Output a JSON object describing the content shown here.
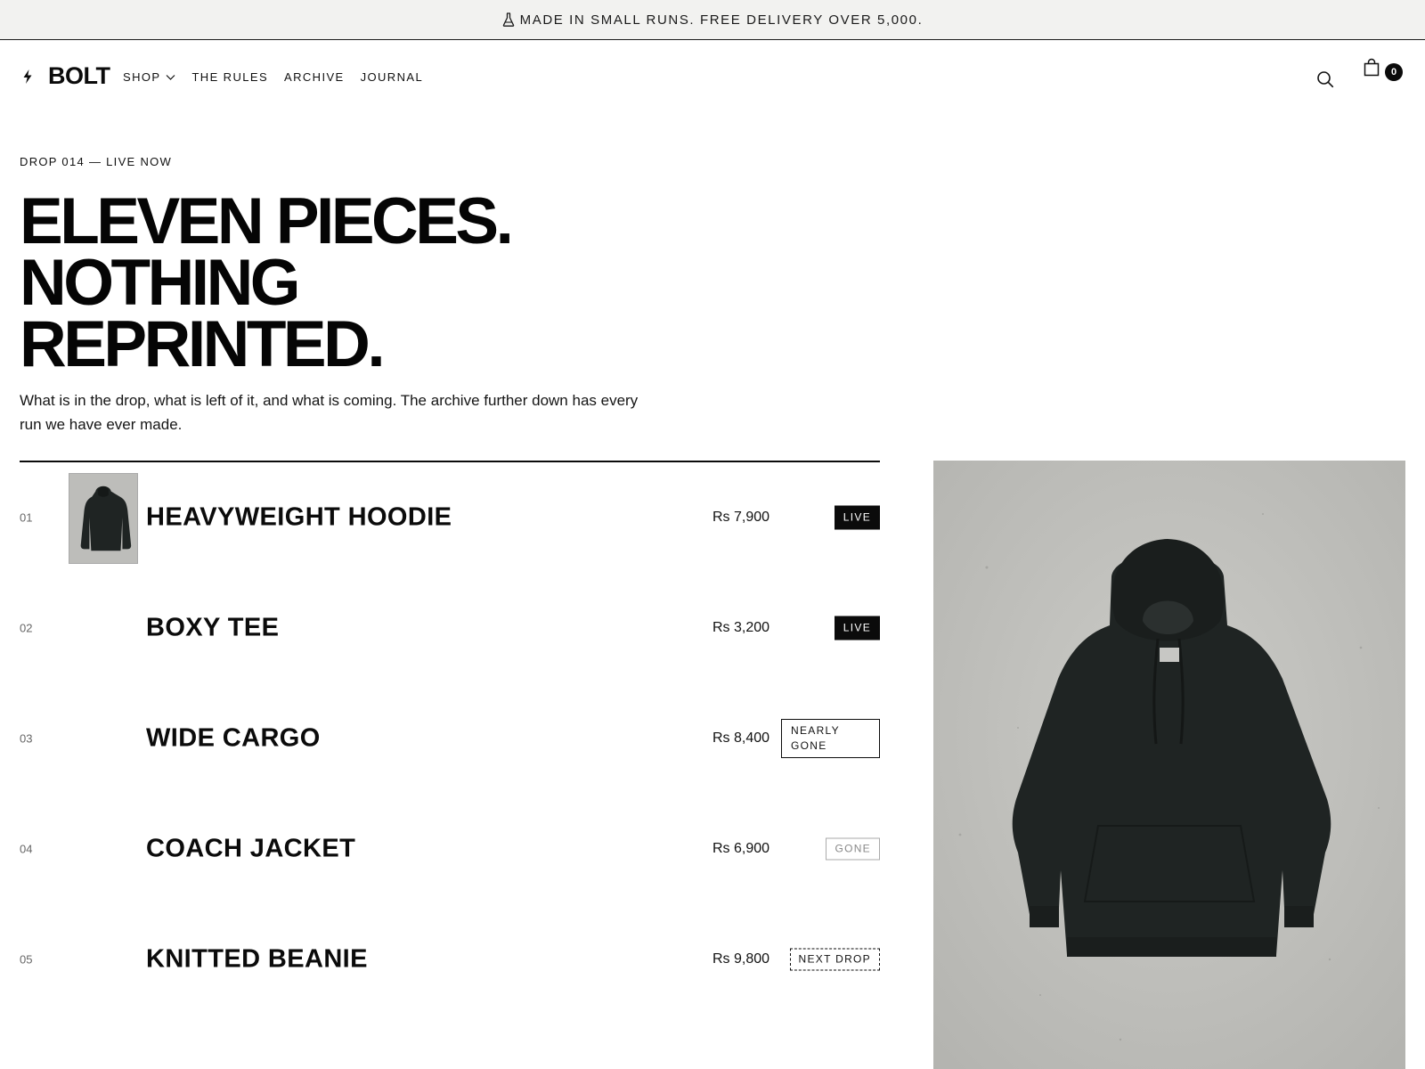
{
  "announcement": {
    "text": "MADE IN SMALL RUNS. FREE DELIVERY OVER 5,000.",
    "icon": "flask-icon"
  },
  "header": {
    "logo": "BOLT",
    "nav": [
      {
        "label": "SHOP",
        "has_dropdown": true
      },
      {
        "label": "THE RULES"
      },
      {
        "label": "ARCHIVE"
      },
      {
        "label": "JOURNAL"
      }
    ],
    "search_icon": "search-icon",
    "cart_icon": "shopping-bag-icon",
    "cart_count": "0"
  },
  "hero": {
    "eyebrow": "DROP 014 — LIVE NOW",
    "headline_lines": [
      "ELEVEN PIECES.",
      "NOTHING",
      "REPRINTED."
    ],
    "lede": "What is in the drop, what is left of it, and what is coming. The archive further down has every run we have ever made."
  },
  "products": [
    {
      "num": "01",
      "name": "HEAVYWEIGHT HOODIE",
      "price": "Rs 7,900",
      "status": "LIVE",
      "has_thumb": true
    },
    {
      "num": "02",
      "name": "BOXY TEE",
      "price": "Rs 3,200",
      "status": "LIVE"
    },
    {
      "num": "03",
      "name": "WIDE CARGO",
      "price": "Rs 8,400",
      "status": "NEARLY GONE"
    },
    {
      "num": "04",
      "name": "COACH JACKET",
      "price": "Rs 6,900",
      "status": "GONE"
    },
    {
      "num": "05",
      "name": "KNITTED BEANIE",
      "price": "Rs 9,800",
      "status": "NEXT DROP"
    }
  ],
  "colors": {
    "ink": "#0b0b0b",
    "announce_bg": "#f2f2f0",
    "concrete": "#c4c4c0",
    "garment": "#1f2423",
    "muted": "#888888"
  }
}
